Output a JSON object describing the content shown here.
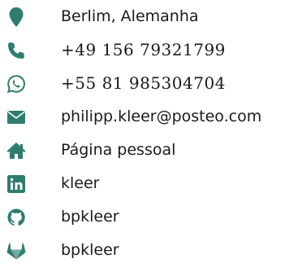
{
  "accent_color": "#2e7d6e",
  "contacts": [
    {
      "icon": "map-marker-icon",
      "text": "Berlim, Alemanha"
    },
    {
      "icon": "phone-icon",
      "text": "+49 156 79321799"
    },
    {
      "icon": "whatsapp-icon",
      "text": "+55 81 985304704"
    },
    {
      "icon": "envelope-icon",
      "text": "philipp.kleer@posteo.com"
    },
    {
      "icon": "home-icon",
      "text": "Página pessoal"
    },
    {
      "icon": "linkedin-icon",
      "text": "kleer"
    },
    {
      "icon": "github-icon",
      "text": "bpkleer"
    },
    {
      "icon": "gitlab-icon",
      "text": "bpkleer"
    }
  ]
}
